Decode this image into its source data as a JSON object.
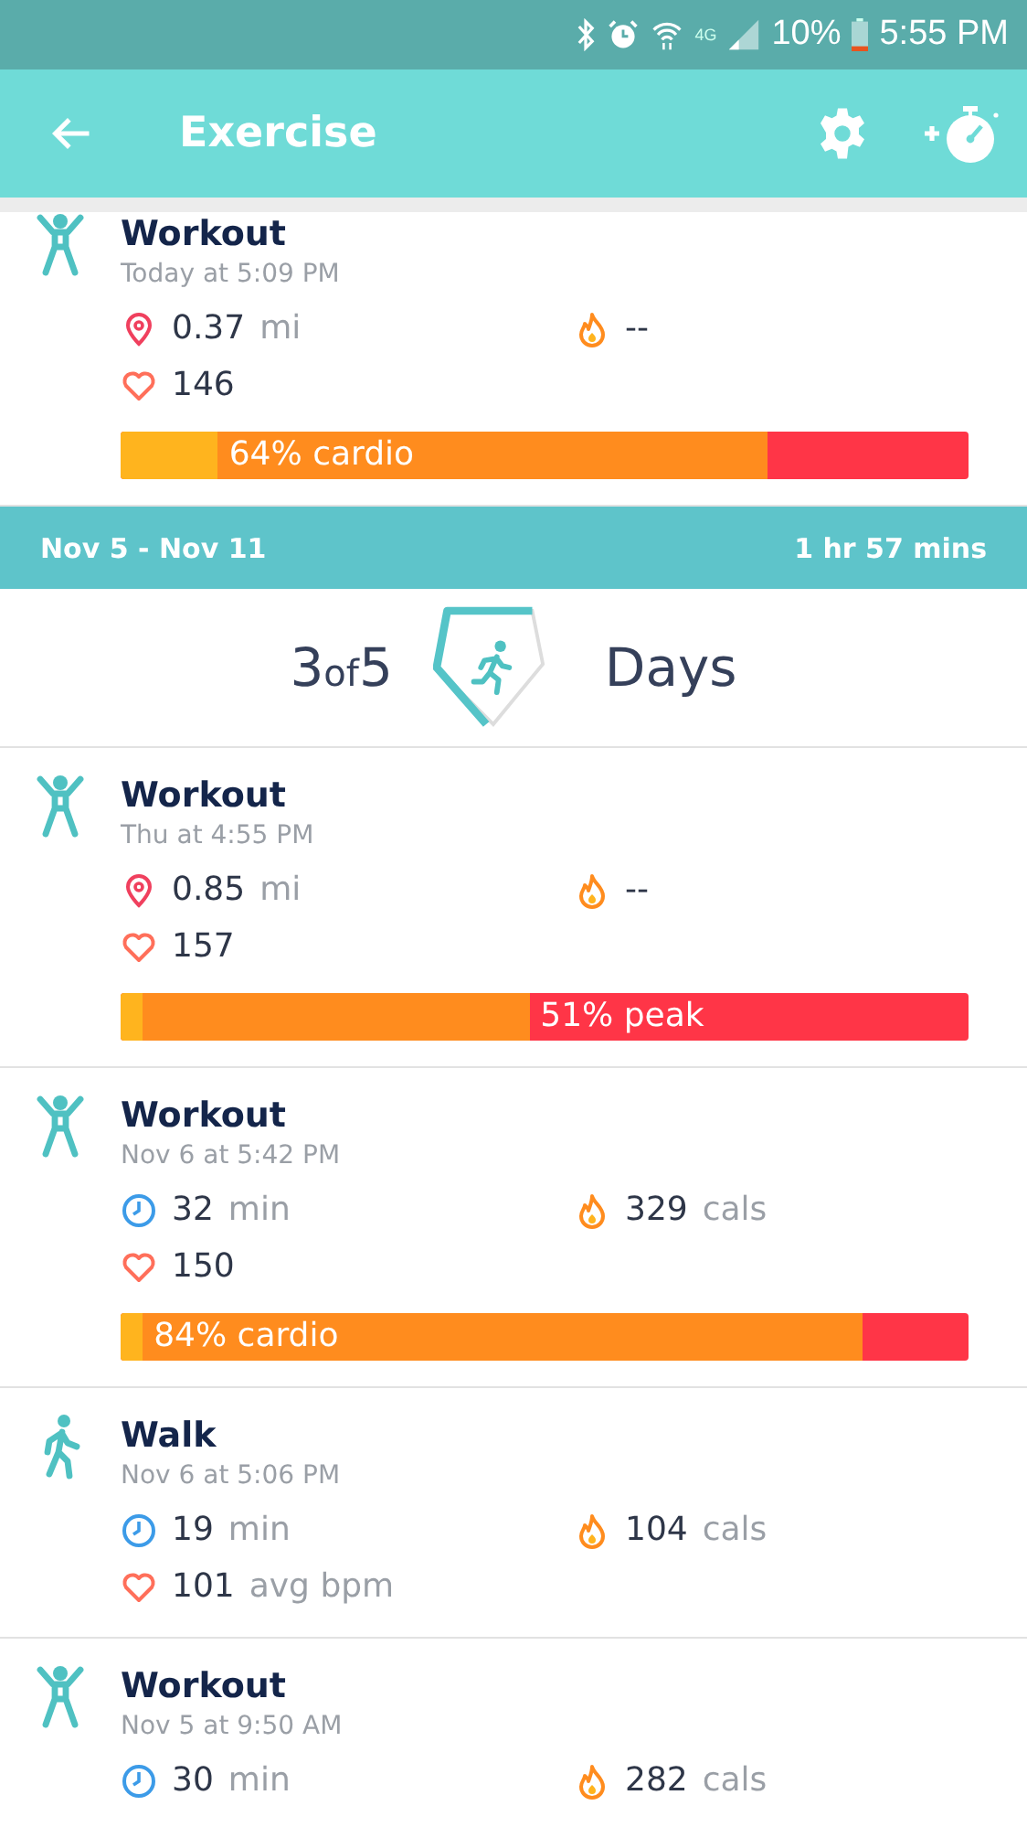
{
  "status_bar": {
    "network": "4G",
    "battery": "10%",
    "time": "5:55 PM"
  },
  "app_bar": {
    "title": "Exercise"
  },
  "sections": [
    {
      "kind": "list",
      "items": [
        {
          "kind": "workout",
          "title": "Workout",
          "time": "Today at 5:09 PM",
          "stats": [
            {
              "kind": "distance",
              "value": "0.37",
              "unit": "mi"
            },
            {
              "kind": "calories",
              "value": "--"
            },
            {
              "kind": "heart",
              "value": "146"
            }
          ],
          "zones": {
            "color": "#ff3547",
            "segments": [
              {
                "level": 0.115,
                "color": "#ffb41e"
              },
              {
                "level": 0.763,
                "color": "#ff8c1e",
                "label": "64% cardio"
              }
            ]
          }
        }
      ]
    },
    {
      "kind": "week",
      "range": "Nov 5 - Nov 11",
      "total": "1 hr 57 mins",
      "goal": {
        "count": "3",
        "of": "of",
        "target": "5",
        "unit": "Days"
      }
    },
    {
      "kind": "list",
      "items": [
        {
          "kind": "workout",
          "title": "Workout",
          "time": "Thu at 4:55 PM",
          "stats": [
            {
              "kind": "distance",
              "value": "0.85",
              "unit": "mi"
            },
            {
              "kind": "calories",
              "value": "--"
            },
            {
              "kind": "heart",
              "value": "157"
            }
          ],
          "zones": {
            "color": "#ff3547",
            "label": "51% peak",
            "segments": [
              {
                "level": 0.026,
                "color": "#ffb41e"
              },
              {
                "level": 0.482,
                "color": "#ff8c1e"
              }
            ]
          }
        },
        {
          "kind": "workout",
          "title": "Workout",
          "time": "Nov 6 at 5:42 PM",
          "stats": [
            {
              "kind": "duration",
              "value": "32",
              "unit": "min"
            },
            {
              "kind": "calories",
              "value": "329",
              "unit": "cals"
            },
            {
              "kind": "heart",
              "value": "150"
            }
          ],
          "zones": {
            "color": "#ff3547",
            "segments": [
              {
                "level": 0.026,
                "color": "#ffb41e"
              },
              {
                "level": 0.875,
                "color": "#ff8c1e",
                "label": "84% cardio"
              }
            ]
          }
        },
        {
          "kind": "walk",
          "title": "Walk",
          "time": "Nov 6 at 5:06 PM",
          "stats": [
            {
              "kind": "duration",
              "value": "19",
              "unit": "min"
            },
            {
              "kind": "calories",
              "value": "104",
              "unit": "cals"
            },
            {
              "kind": "heart",
              "value": "101",
              "unit": "avg bpm"
            }
          ]
        },
        {
          "kind": "workout",
          "title": "Workout",
          "time": "Nov 5 at 9:50 AM",
          "stats": [
            {
              "kind": "duration",
              "value": "30",
              "unit": "min"
            },
            {
              "kind": "calories",
              "value": "282",
              "unit": "cals"
            }
          ]
        }
      ]
    }
  ]
}
